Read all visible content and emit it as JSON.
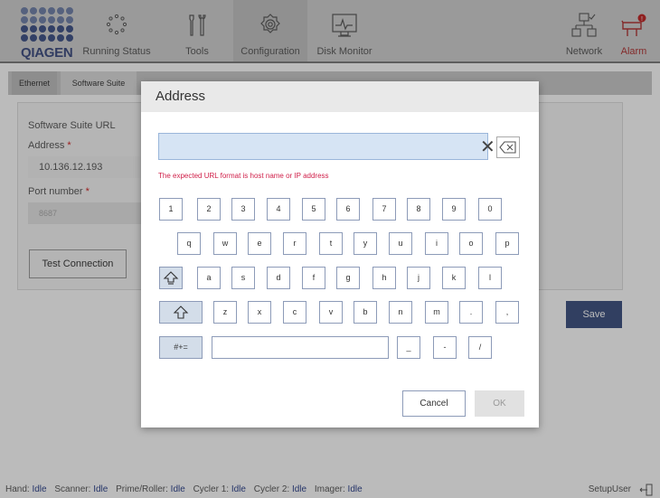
{
  "nav": {
    "logo_text": "QIAGEN",
    "items": [
      {
        "label": "Running Status",
        "icon": "running-status-icon"
      },
      {
        "label": "Tools",
        "icon": "tools-icon"
      },
      {
        "label": "Configuration",
        "icon": "configuration-icon"
      },
      {
        "label": "Disk Monitor",
        "icon": "disk-monitor-icon"
      },
      {
        "label": "Network",
        "icon": "network-icon"
      },
      {
        "label": "Alarm",
        "icon": "alarm-icon"
      }
    ],
    "active": "Configuration"
  },
  "subtabs": [
    {
      "label": "Ethernet"
    },
    {
      "label": "Software Suite"
    }
  ],
  "form": {
    "section_title": "Software Suite URL",
    "address_label": "Address",
    "address_value": "10.136.12.193",
    "port_label": "Port number",
    "port_value": "8687",
    "required_mark": "*",
    "test_button": "Test Connection",
    "save_button": "Save"
  },
  "dialog": {
    "title": "Address",
    "input_value": "",
    "error": "The expected URL format is host name or IP address",
    "keys_row1": [
      "1",
      "2",
      "3",
      "4",
      "5",
      "6",
      "7",
      "8",
      "9",
      "0"
    ],
    "keys_row2": [
      "q",
      "w",
      "e",
      "r",
      "t",
      "y",
      "u",
      "i",
      "o",
      "p"
    ],
    "keys_row3": [
      "a",
      "s",
      "d",
      "f",
      "g",
      "h",
      "j",
      "k",
      "l"
    ],
    "keys_row4": [
      "z",
      "x",
      "c",
      "v",
      "b",
      "n",
      "m",
      ".",
      ","
    ],
    "symbols_key": "#+=",
    "keys_row5": [
      "_",
      "-",
      "/"
    ],
    "cancel": "Cancel",
    "ok": "OK"
  },
  "status": {
    "items": [
      {
        "label": "Hand:",
        "value": "Idle"
      },
      {
        "label": "Scanner:",
        "value": "Idle"
      },
      {
        "label": "Prime/Roller:",
        "value": "Idle"
      },
      {
        "label": "Cycler 1:",
        "value": "Idle"
      },
      {
        "label": "Cycler 2:",
        "value": "Idle"
      },
      {
        "label": "Imager:",
        "value": "Idle"
      }
    ],
    "user": "SetupUser"
  },
  "colors": {
    "brand": "#3a4a7f",
    "accent": "#3a4e7e",
    "error": "#d0204a",
    "alarm": "#b03030"
  }
}
